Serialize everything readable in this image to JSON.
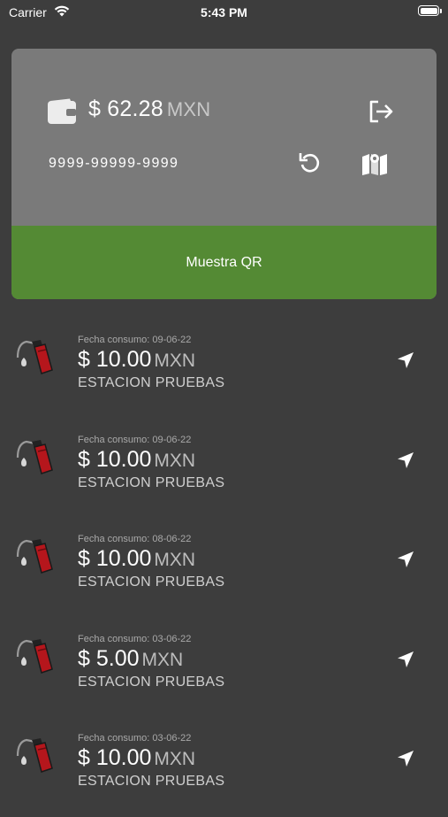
{
  "status_bar": {
    "carrier": "Carrier",
    "time": "5:43 PM"
  },
  "card": {
    "balance_amount": "$ 62.28",
    "balance_currency": "MXN",
    "card_number": "9999-99999-9999",
    "qr_button_label": "Muestra QR",
    "icons": [
      "wallet-icon",
      "logout-icon",
      "refresh-icon",
      "map-icon"
    ]
  },
  "colors": {
    "background": "#3d3d3d",
    "card": "#7a7a7a",
    "qr_button": "#548a34",
    "pump_red": "#b5161c"
  },
  "transactions": [
    {
      "date": "Fecha consumo: 09-06-22",
      "amount": "$ 10.00",
      "currency": "MXN",
      "station": "ESTACION PRUEBAS"
    },
    {
      "date": "Fecha consumo: 09-06-22",
      "amount": "$ 10.00",
      "currency": "MXN",
      "station": "ESTACION PRUEBAS"
    },
    {
      "date": "Fecha consumo: 08-06-22",
      "amount": "$ 10.00",
      "currency": "MXN",
      "station": "ESTACION PRUEBAS"
    },
    {
      "date": "Fecha consumo: 03-06-22",
      "amount": "$ 5.00",
      "currency": "MXN",
      "station": "ESTACION PRUEBAS"
    },
    {
      "date": "Fecha consumo: 03-06-22",
      "amount": "$ 10.00",
      "currency": "MXN",
      "station": "ESTACION PRUEBAS"
    }
  ]
}
